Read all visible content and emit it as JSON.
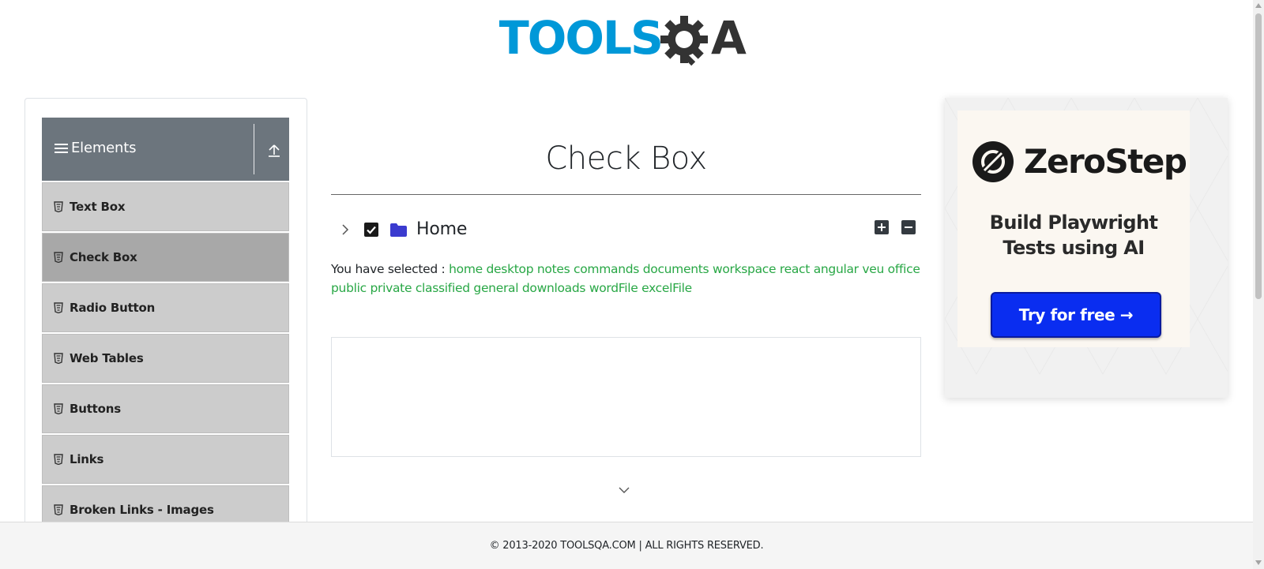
{
  "logo": {
    "text_tools": "TOOLS",
    "text_a": "A",
    "brand_blue": "#0098d8",
    "brand_dark": "#333333"
  },
  "sidebar": {
    "group_title": "Elements",
    "header_color": "#6c757d",
    "items": [
      {
        "label": "Text Box",
        "active": false
      },
      {
        "label": "Check Box",
        "active": true
      },
      {
        "label": "Radio Button",
        "active": false
      },
      {
        "label": "Web Tables",
        "active": false
      },
      {
        "label": "Buttons",
        "active": false
      },
      {
        "label": "Links",
        "active": false
      },
      {
        "label": "Broken Links - Images",
        "active": false
      }
    ]
  },
  "main": {
    "page_title": "Check Box",
    "tree": {
      "root_label": "Home",
      "checked": true,
      "expanded": false
    },
    "result": {
      "label": "You have selected :",
      "selected": [
        "home",
        "desktop",
        "notes",
        "commands",
        "documents",
        "workspace",
        "react",
        "angular",
        "veu",
        "office",
        "public",
        "private",
        "classified",
        "general",
        "downloads",
        "wordFile",
        "excelFile"
      ],
      "selected_color": "#28a745"
    }
  },
  "ad": {
    "brand": "ZeroStep",
    "tagline_line1": "Build Playwright",
    "tagline_line2": "Tests using AI",
    "cta": "Try for free →",
    "cta_color": "#0a2df0"
  },
  "footer": {
    "copyright": "© 2013-2020 TOOLSQA.COM | ALL RIGHTS RESERVED."
  }
}
